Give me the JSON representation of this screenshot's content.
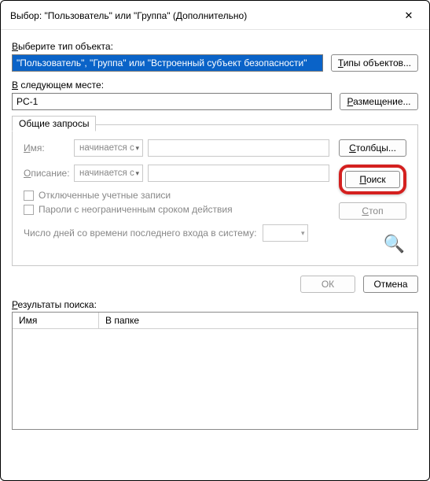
{
  "window": {
    "title": "Выбор: \"Пользователь\" или \"Группа\" (Дополнительно)",
    "close_glyph": "✕"
  },
  "objectType": {
    "label_prefix": "В",
    "label_rest": "ыберите тип объекта:",
    "value": "\"Пользователь\", \"Группа\" или \"Встроенный субъект безопасности\"",
    "button_underline": "Т",
    "button_rest": "ипы объектов..."
  },
  "location": {
    "label_underline": "В",
    "label_rest": " следующем месте:",
    "value": "PC-1",
    "button_underline": "Р",
    "button_rest": "азмещение..."
  },
  "queries": {
    "tab_label": "Общие запросы",
    "name": {
      "label_underline": "И",
      "label_rest": "мя:",
      "select_value": "начинается с"
    },
    "description": {
      "label_underline": "О",
      "label_rest": "писание:",
      "select_value": "начинается с"
    },
    "chk_disabled": "Отключенные учетные записи",
    "chk_noexpire": "Пароли с неограниченным сроком действия",
    "days_label": "Число дней со времени последнего входа в систему:"
  },
  "sideButtons": {
    "columns_underline": "С",
    "columns_rest": "толбцы...",
    "search_underline": "П",
    "search_rest": "оиск",
    "stop_underline": "С",
    "stop_rest": "топ"
  },
  "footer": {
    "ok": "ОК",
    "cancel": "Отмена"
  },
  "results": {
    "label_underline": "Р",
    "label_rest": "езультаты поиска:",
    "col_name": "Имя",
    "col_folder": "В папке"
  }
}
